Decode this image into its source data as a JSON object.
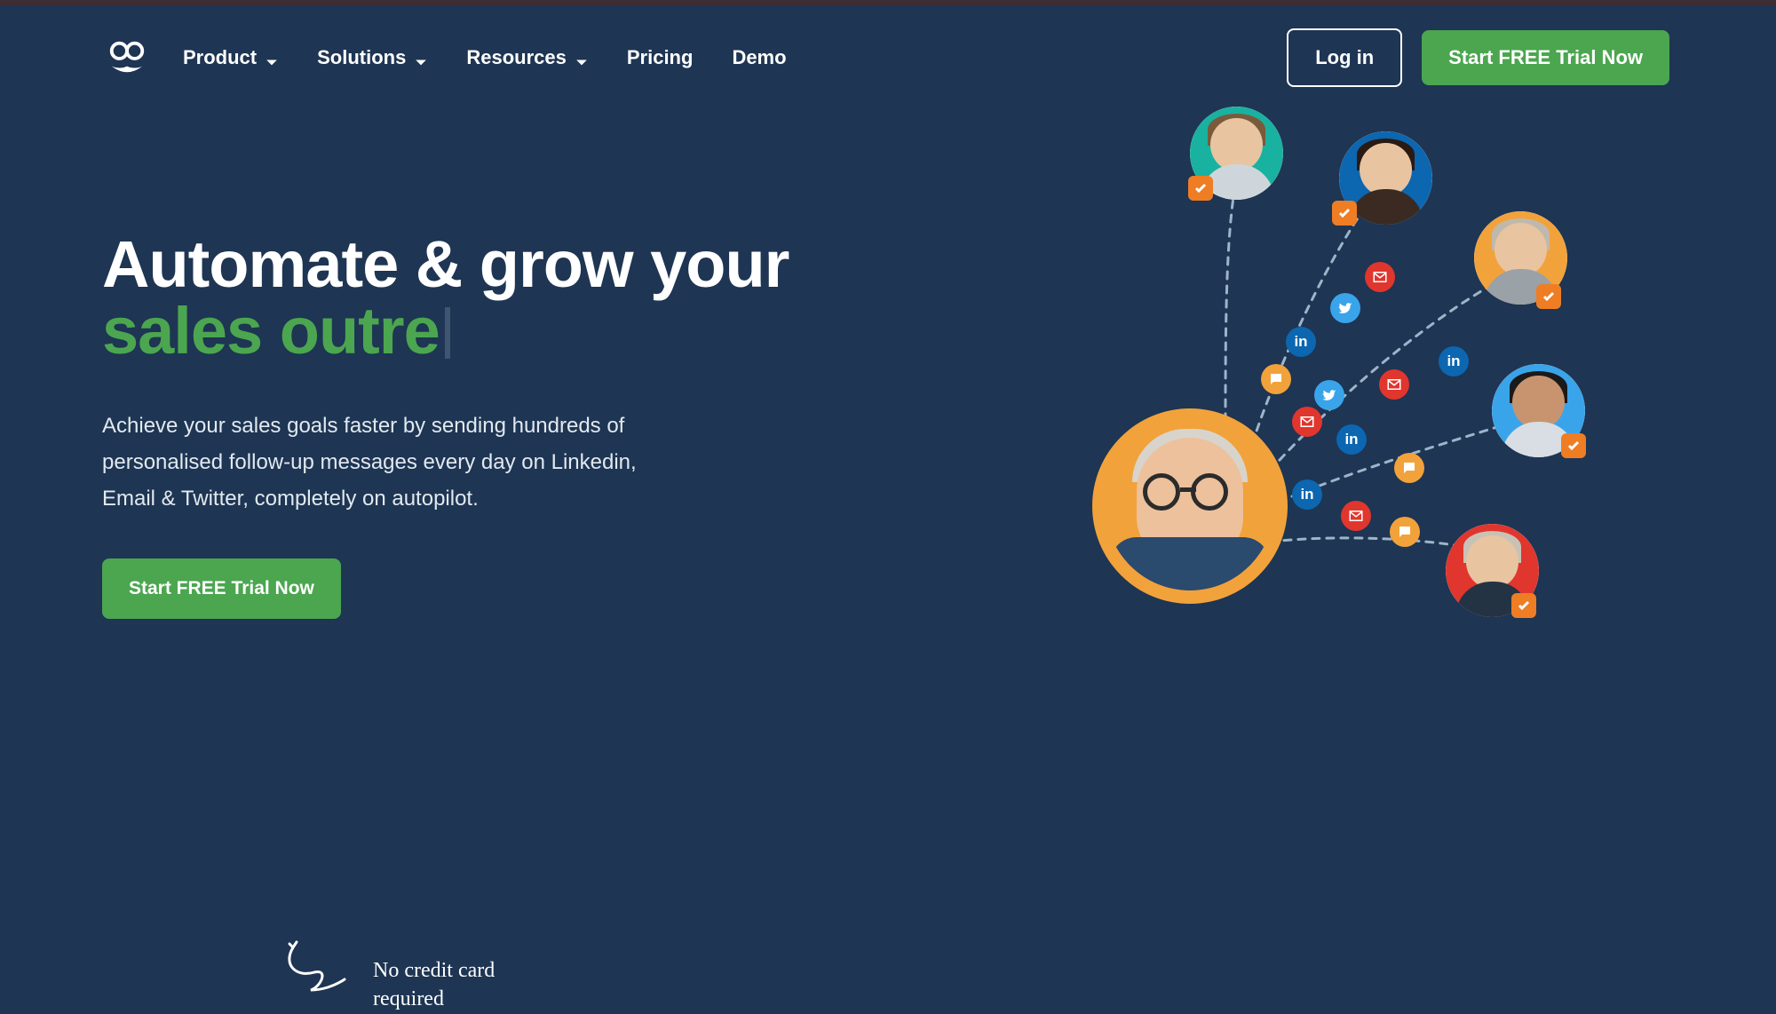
{
  "nav": {
    "items": [
      {
        "label": "Product",
        "dropdown": true
      },
      {
        "label": "Solutions",
        "dropdown": true
      },
      {
        "label": "Resources",
        "dropdown": true
      },
      {
        "label": "Pricing",
        "dropdown": false
      },
      {
        "label": "Demo",
        "dropdown": false
      }
    ],
    "login_label": "Log in",
    "trial_label": "Start FREE Trial Now"
  },
  "hero": {
    "headline_static": "Automate & grow your",
    "headline_typed": "sales outre",
    "subcopy": "Achieve your sales goals faster by sending hundreds of personalised follow-up messages every day on Linkedin, Email & Twitter, completely on autopilot.",
    "cta_label": "Start FREE Trial Now",
    "no_cc": "No credit card\nrequired"
  },
  "colors": {
    "bg": "#1e3553",
    "accent_green": "#4ba64f",
    "accent_orange": "#ee7d24"
  },
  "illustration": {
    "network_icons": [
      "twitter",
      "linkedin",
      "email",
      "chat"
    ],
    "contacts": 6
  }
}
